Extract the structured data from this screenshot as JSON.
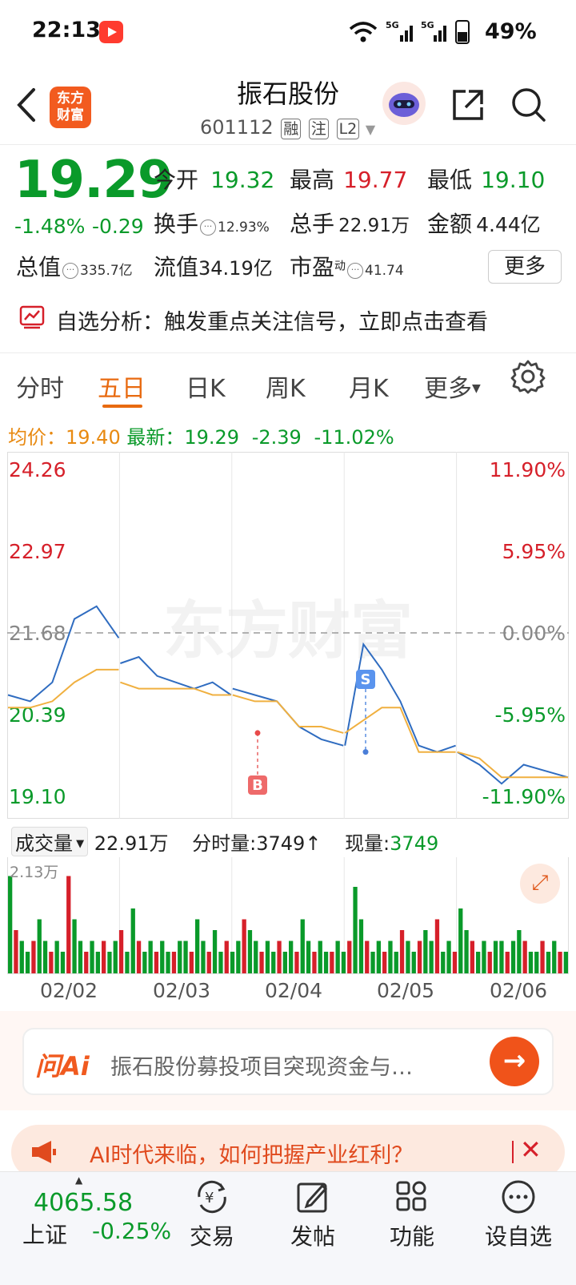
{
  "status_bar": {
    "time": "22:13",
    "battery": "49%",
    "signal_label": "5G"
  },
  "header": {
    "logo_line1": "东方",
    "logo_line2": "财富",
    "title": "振石股份",
    "code": "601112",
    "tags": [
      "融",
      "注",
      "L2"
    ]
  },
  "quote": {
    "price": "19.29",
    "change_pct": "-1.48%",
    "change": "-0.29",
    "open_label": "今开",
    "open": "19.32",
    "high_label": "最高",
    "high": "19.77",
    "low_label": "最低",
    "low": "19.10",
    "turnover_label": "换手",
    "turnover": "12.93%",
    "volume_label": "总手",
    "volume": "22.91万",
    "amount_label": "金额",
    "amount": "4.44亿",
    "mktcap_label": "总值",
    "mktcap": "335.7亿",
    "float_label": "流值",
    "float": "34.19亿",
    "pe_label": "市盈",
    "pe_sup": "动",
    "pe": "41.74",
    "more_label": "更多"
  },
  "alert": {
    "text": "自选分析：触发重点关注信号，立即点击查看"
  },
  "tabs": [
    "分时",
    "五日",
    "日K",
    "周K",
    "月K",
    "更多"
  ],
  "avg_row": {
    "avg_label": "均价：",
    "avg": "19.40",
    "latest_label": "最新：",
    "latest": "19.29",
    "chg": "-2.39",
    "chg_pct": "-11.02%"
  },
  "chart_data": {
    "type": "line",
    "title": "",
    "series": [
      {
        "values": [
          20.7,
          20.6,
          20.9,
          21.9,
          22.1,
          21.6,
          21.2,
          21.3,
          21.0,
          20.9,
          20.8,
          20.9,
          20.7,
          20.8,
          20.7,
          20.6,
          20.2,
          20.0,
          19.9,
          19.9,
          21.5,
          21.1,
          20.6,
          19.9,
          19.8,
          19.9,
          19.8,
          19.6,
          19.3,
          19.6,
          19.5,
          19.4
        ]
      },
      {
        "values": [
          20.5,
          20.5,
          20.6,
          20.9,
          21.1,
          21.1,
          20.9,
          20.8,
          20.8,
          20.8,
          20.8,
          20.7,
          20.7,
          20.7,
          20.6,
          20.6,
          20.2,
          20.2,
          20.1,
          20.1,
          20.3,
          20.5,
          20.5,
          19.8,
          19.8,
          19.8,
          19.8,
          19.7,
          19.4,
          19.4,
          19.4,
          19.4
        ]
      }
    ],
    "x": [
      "02/02",
      "02/03",
      "02/04",
      "02/05",
      "02/06"
    ],
    "ylim": [
      19.1,
      24.26
    ],
    "y_ticks_left": [
      "24.26",
      "22.97",
      "21.68",
      "20.39",
      "19.10"
    ],
    "y_ticks_right": [
      "11.90%",
      "5.95%",
      "0.00%",
      "-5.95%",
      "-11.90%"
    ],
    "markers": [
      "B",
      "S"
    ],
    "watermark": "东方财富"
  },
  "volume": {
    "selector": "成交量",
    "total": "22.91万",
    "tick_label": "分时量:3749",
    "now_label": "现量:",
    "now": "3749",
    "max_label": "2.13万",
    "bars": [
      0.9,
      0.4,
      0.3,
      0.2,
      0.3,
      0.5,
      0.3,
      0.2,
      0.3,
      0.2,
      0.9,
      0.5,
      0.3,
      0.2,
      0.3,
      0.2,
      0.3,
      0.2,
      0.3,
      0.4,
      0.2,
      0.6,
      0.3,
      0.2,
      0.3,
      0.2,
      0.3,
      0.2,
      0.2,
      0.3,
      0.3,
      0.2,
      0.5,
      0.3,
      0.2,
      0.4,
      0.2,
      0.3,
      0.2,
      0.3,
      0.5,
      0.4,
      0.3,
      0.2,
      0.3,
      0.2,
      0.3,
      0.2,
      0.3,
      0.2,
      0.5,
      0.3,
      0.2,
      0.3,
      0.2,
      0.2,
      0.3,
      0.2,
      0.3,
      0.8,
      0.5,
      0.3,
      0.2,
      0.3,
      0.2,
      0.3,
      0.2,
      0.4,
      0.3,
      0.2,
      0.3,
      0.4,
      0.3,
      0.5,
      0.2,
      0.3,
      0.2,
      0.6,
      0.4,
      0.3,
      0.2,
      0.3,
      0.2,
      0.3,
      0.3,
      0.2,
      0.3,
      0.4,
      0.3,
      0.2,
      0.2,
      0.3,
      0.2,
      0.3,
      0.2,
      0.2
    ]
  },
  "dates": [
    "02/02",
    "02/03",
    "02/04",
    "02/05",
    "02/06"
  ],
  "ai_bar": {
    "logo": "问Ai",
    "text": "振石股份募投项目突现资金与…"
  },
  "banner": {
    "text": "AI时代来临，如何把握产业红利？"
  },
  "bottom_nav": {
    "index_value": "4065.58",
    "index_name": "上证",
    "index_pct": "-0.25%",
    "items": [
      "交易",
      "发帖",
      "功能",
      "设自选"
    ]
  },
  "colors": {
    "up": "#d6202a",
    "down": "#0a9a2a",
    "accent": "#e86a10",
    "price_line": "#2f6cc0",
    "avg_line": "#f0b040"
  }
}
